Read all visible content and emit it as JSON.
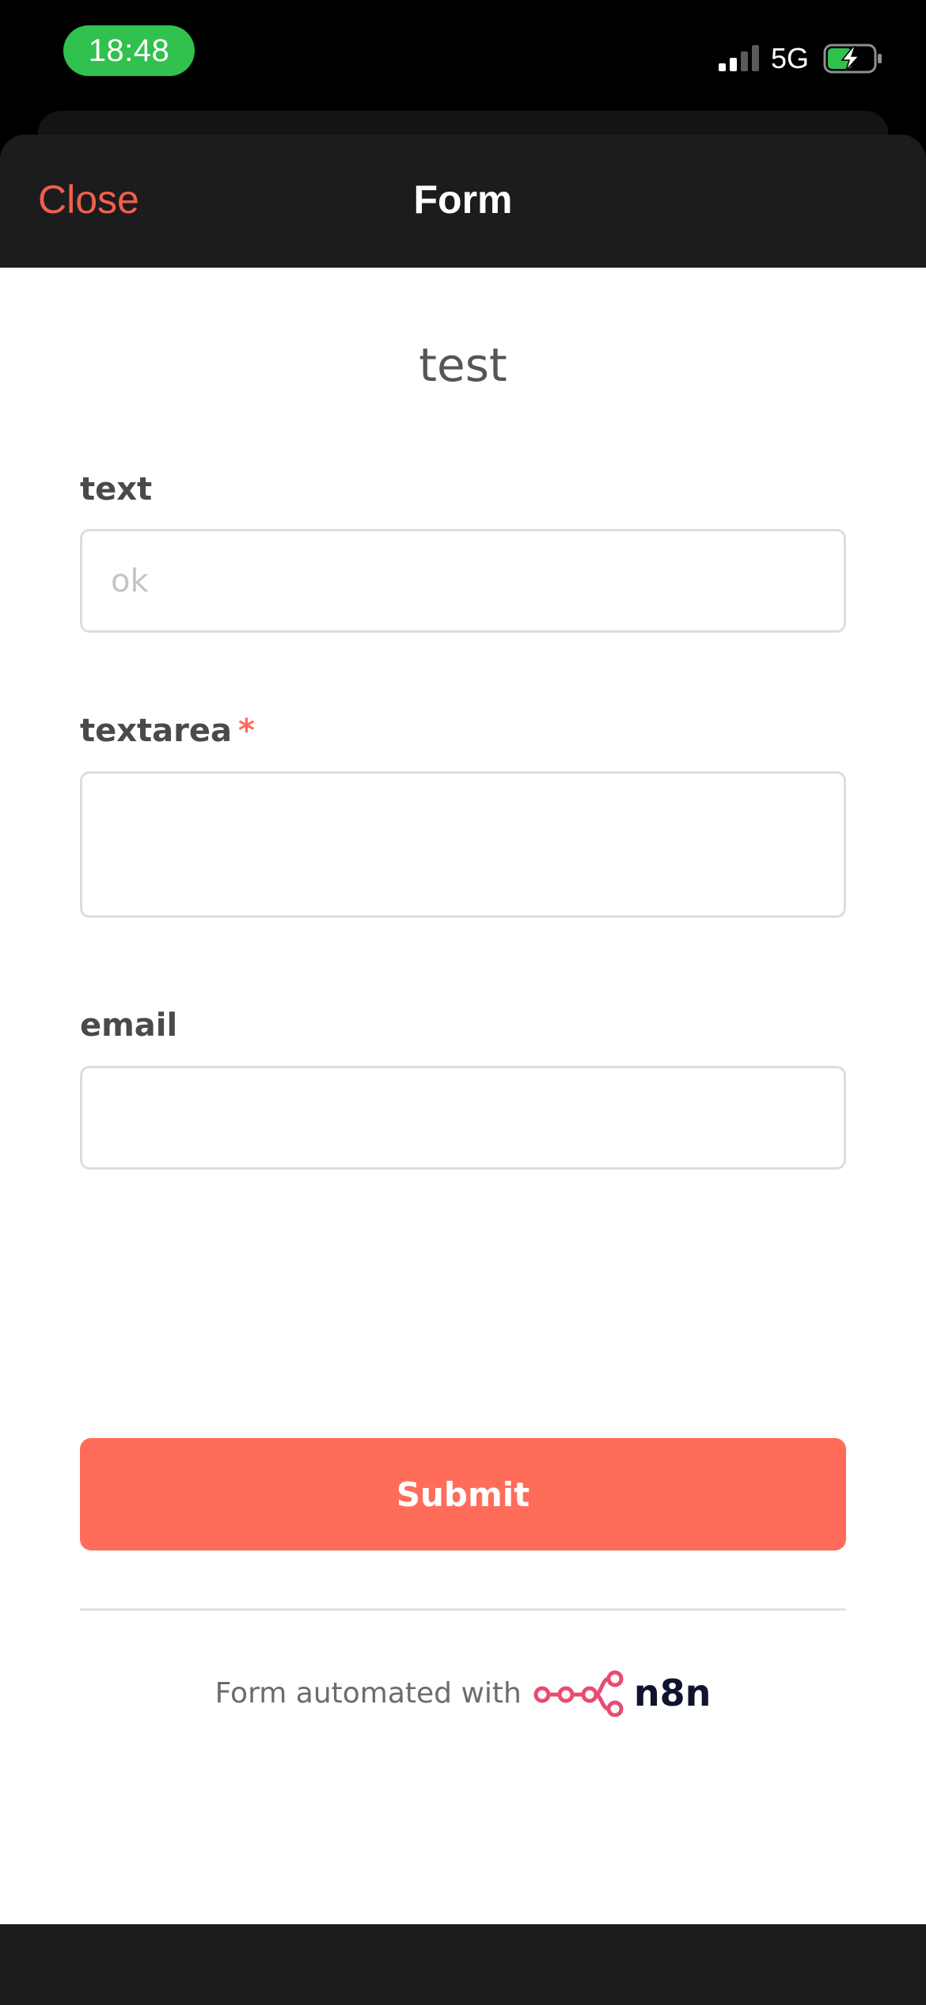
{
  "status_bar": {
    "time": "18:48",
    "network": "5G",
    "time_pill_color": "#30c14e",
    "icons": [
      "signal-icon",
      "battery-charging-icon"
    ]
  },
  "nav": {
    "close_label": "Close",
    "title": "Form",
    "accent_color": "#f0604d"
  },
  "form": {
    "title": "test",
    "fields": [
      {
        "label": "text",
        "type": "text",
        "placeholder": "ok",
        "value": "",
        "required": false
      },
      {
        "label": "textarea",
        "type": "textarea",
        "placeholder": "",
        "value": "",
        "required": true,
        "required_marker": "*"
      },
      {
        "label": "email",
        "type": "email",
        "placeholder": "",
        "value": "",
        "required": false
      }
    ],
    "submit_label": "Submit",
    "submit_color": "#ff6d5a"
  },
  "footer": {
    "text": "Form automated with",
    "brand": "n8n",
    "brand_icon": "n8n-logo-icon",
    "brand_icon_color": "#ea4b71"
  }
}
